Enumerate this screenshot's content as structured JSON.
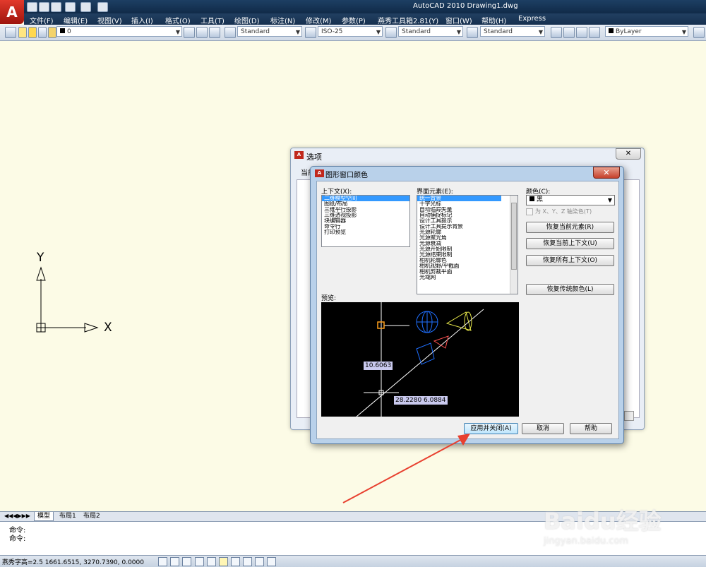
{
  "window": {
    "title": "AutoCAD 2010     Drawing1.dwg"
  },
  "menu": [
    "文件(F)",
    "编辑(E)",
    "视图(V)",
    "插入(I)",
    "格式(O)",
    "工具(T)",
    "绘图(D)",
    "标注(N)",
    "修改(M)",
    "参数(P)",
    "燕秀工具箱2.81(Y)",
    "窗口(W)",
    "帮助(H)",
    "Express"
  ],
  "toolbar": {
    "layer_value": "0",
    "text_style": "Standard",
    "dim_style": "ISO-25",
    "table_style": "Standard",
    "mleader_style": "Standard",
    "color_value": "ByLayer"
  },
  "ucs": {
    "y_label": "Y",
    "x_label": "X"
  },
  "options_dialog": {
    "title": "选项",
    "tab_stub": "当前",
    "close": "✕"
  },
  "color_dialog": {
    "title": "图形窗口颜色",
    "close": "✕",
    "context_label": "上下文(X):",
    "contexts": [
      "二维模型空间",
      "图纸/布局",
      "三维平行投影",
      "三维透视投影",
      "块编辑器",
      "命令行",
      "打印预览"
    ],
    "elements_label": "界面元素(E):",
    "elements": [
      "统一背景",
      "十字光标",
      "自动追踪矢量",
      "自动捕捉标记",
      "设计工具提示",
      "设计工具提示背景",
      "光源轮廓",
      "光源聚光角",
      "光源衰减",
      "光源开始限制",
      "光源结束限制",
      "相机轮廓色",
      "相机视野/平截面",
      "相机剪裁平面",
      "光域网"
    ],
    "color_label": "颜色(C):",
    "color_value": "黑",
    "axis_tint": "为 X、Y、Z 轴染色(T)",
    "restore_element": "恢复当前元素(R)",
    "restore_context": "恢复当前上下文(U)",
    "restore_all": "恢复所有上下文(O)",
    "restore_classic": "恢复传统颜色(L)",
    "preview_label": "预览:",
    "dim1": "10.6063",
    "dim2": "28.2280",
    "dim3": "6.0884",
    "apply_close": "应用并关闭(A)",
    "cancel": "取消",
    "help": "帮助"
  },
  "layout_tabs": [
    "模型",
    "布局1",
    "布局2"
  ],
  "command_lines": [
    "命令:",
    "命令:"
  ],
  "status": {
    "text": "燕秀字高=2.5  1661.6515, 3270.7390, 0.0000"
  },
  "watermark": {
    "brand": "Baidu经验",
    "url": "jingyan.baidu.com"
  },
  "colors": {
    "arrow": "#e8402f",
    "selection": "#3399ff",
    "model_bg": "#fcfbe6"
  }
}
